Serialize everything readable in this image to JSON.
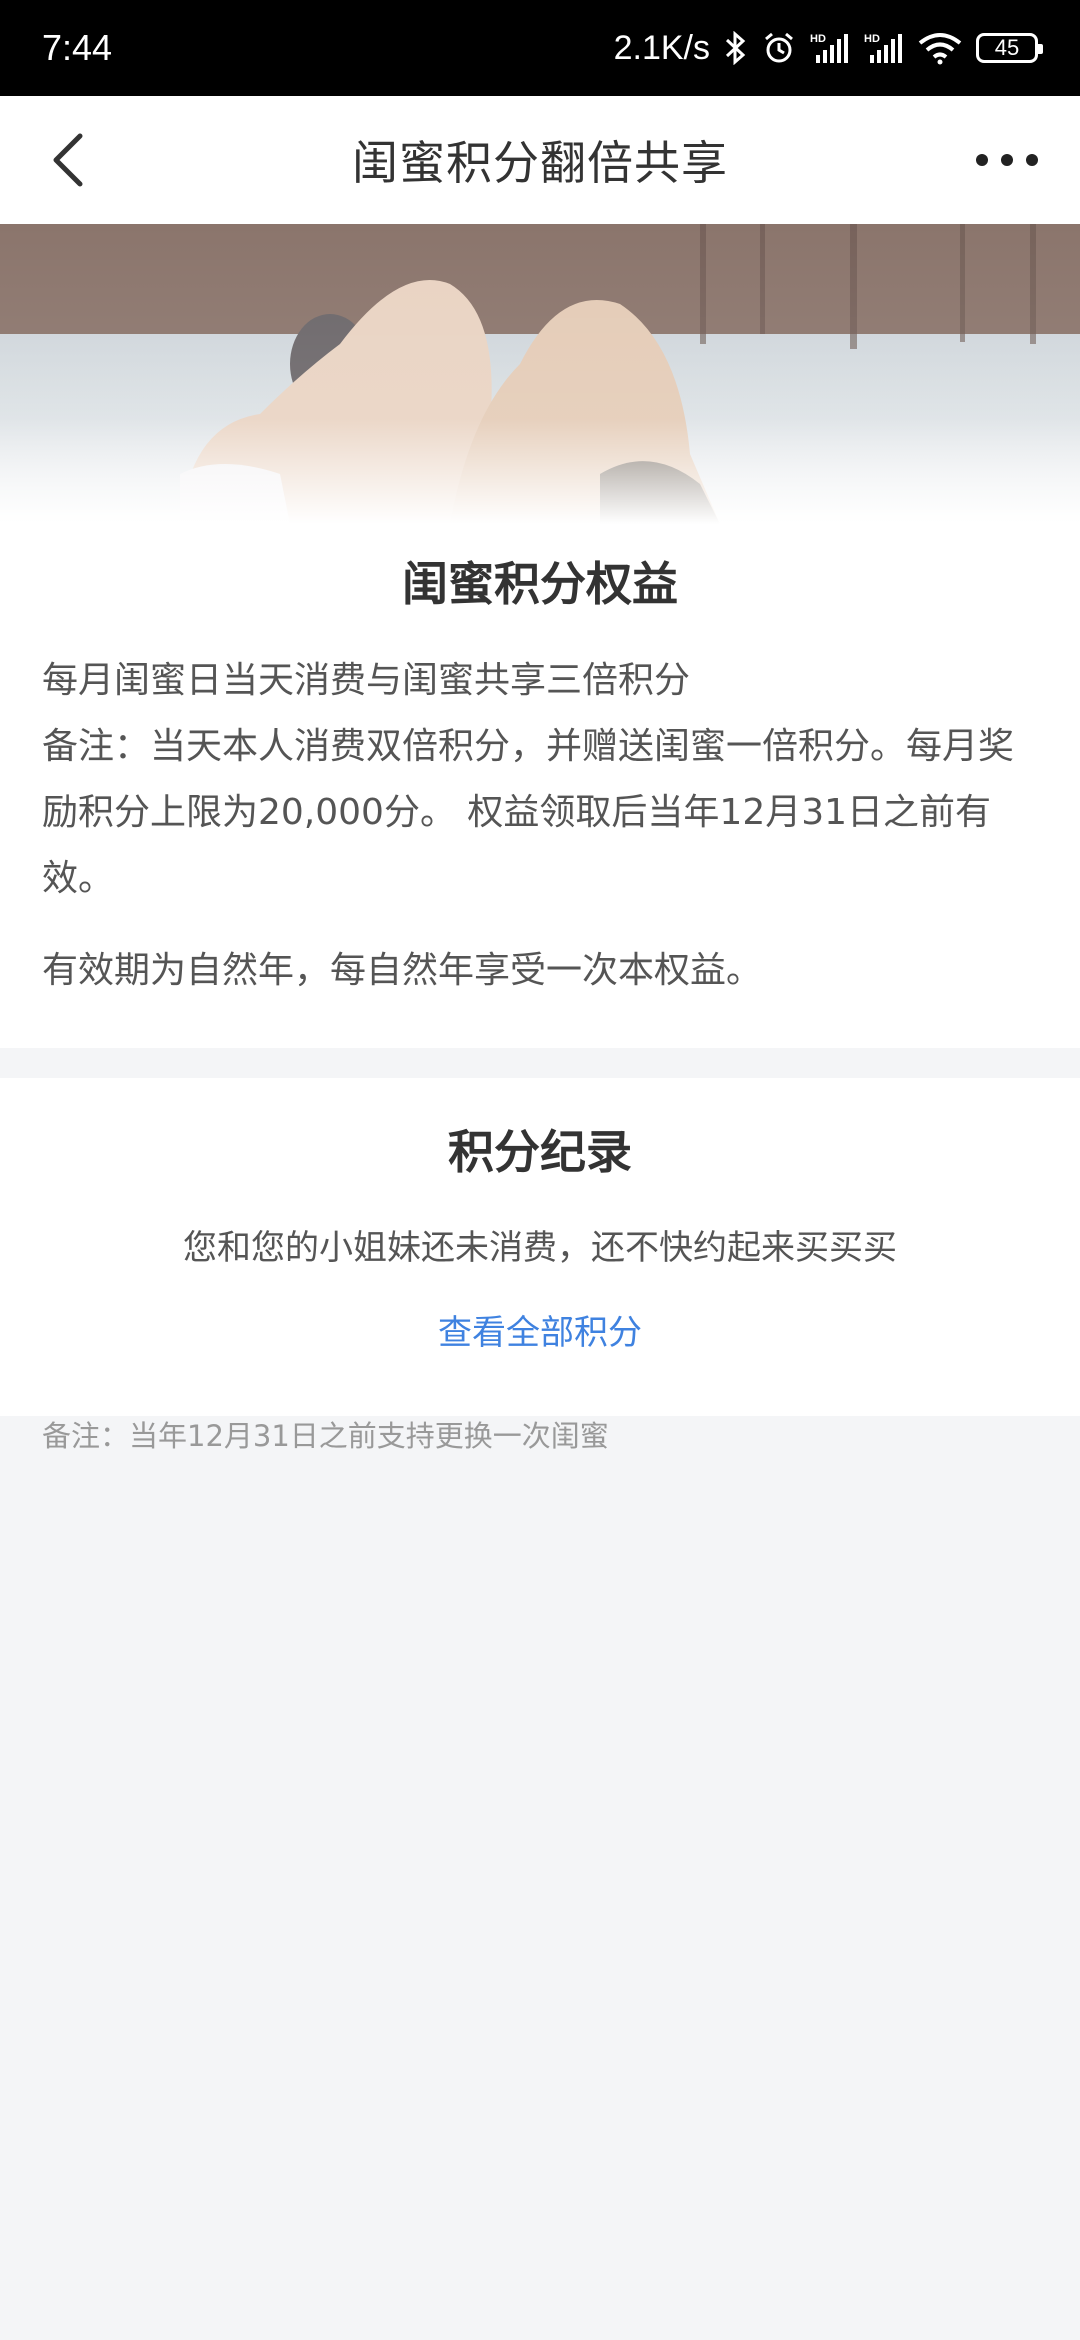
{
  "status_bar": {
    "time": "7:44",
    "speed": "2.1K/s",
    "battery": "45",
    "icons": [
      "bluetooth-icon",
      "alarm-icon",
      "signal-hd-icon",
      "signal-hd-icon",
      "wifi-icon",
      "battery-icon"
    ]
  },
  "nav": {
    "title": "闺蜜积分翻倍共享",
    "back_icon": "chevron-left-icon",
    "more_icon": "more-horizontal-icon"
  },
  "benefits": {
    "title": "闺蜜积分权益",
    "line1": "每月闺蜜日当天消费与闺蜜共享三倍积分",
    "line2": "备注：当天本人消费双倍积分，并赠送闺蜜一倍积分。每月奖励积分上限为20,000分。 权益领取后当年12月31日之前有效。",
    "line3": "有效期为自然年，每自然年享受一次本权益。"
  },
  "records": {
    "title": "积分纪录",
    "empty_text": "您和您的小姐妹还未消费，还不快约起来买买买",
    "view_all": "查看全部积分"
  },
  "footer_note": "备注：当年12月31日之前支持更换一次闺蜜",
  "colors": {
    "link": "#3f82e0",
    "background": "#f4f5f7"
  }
}
